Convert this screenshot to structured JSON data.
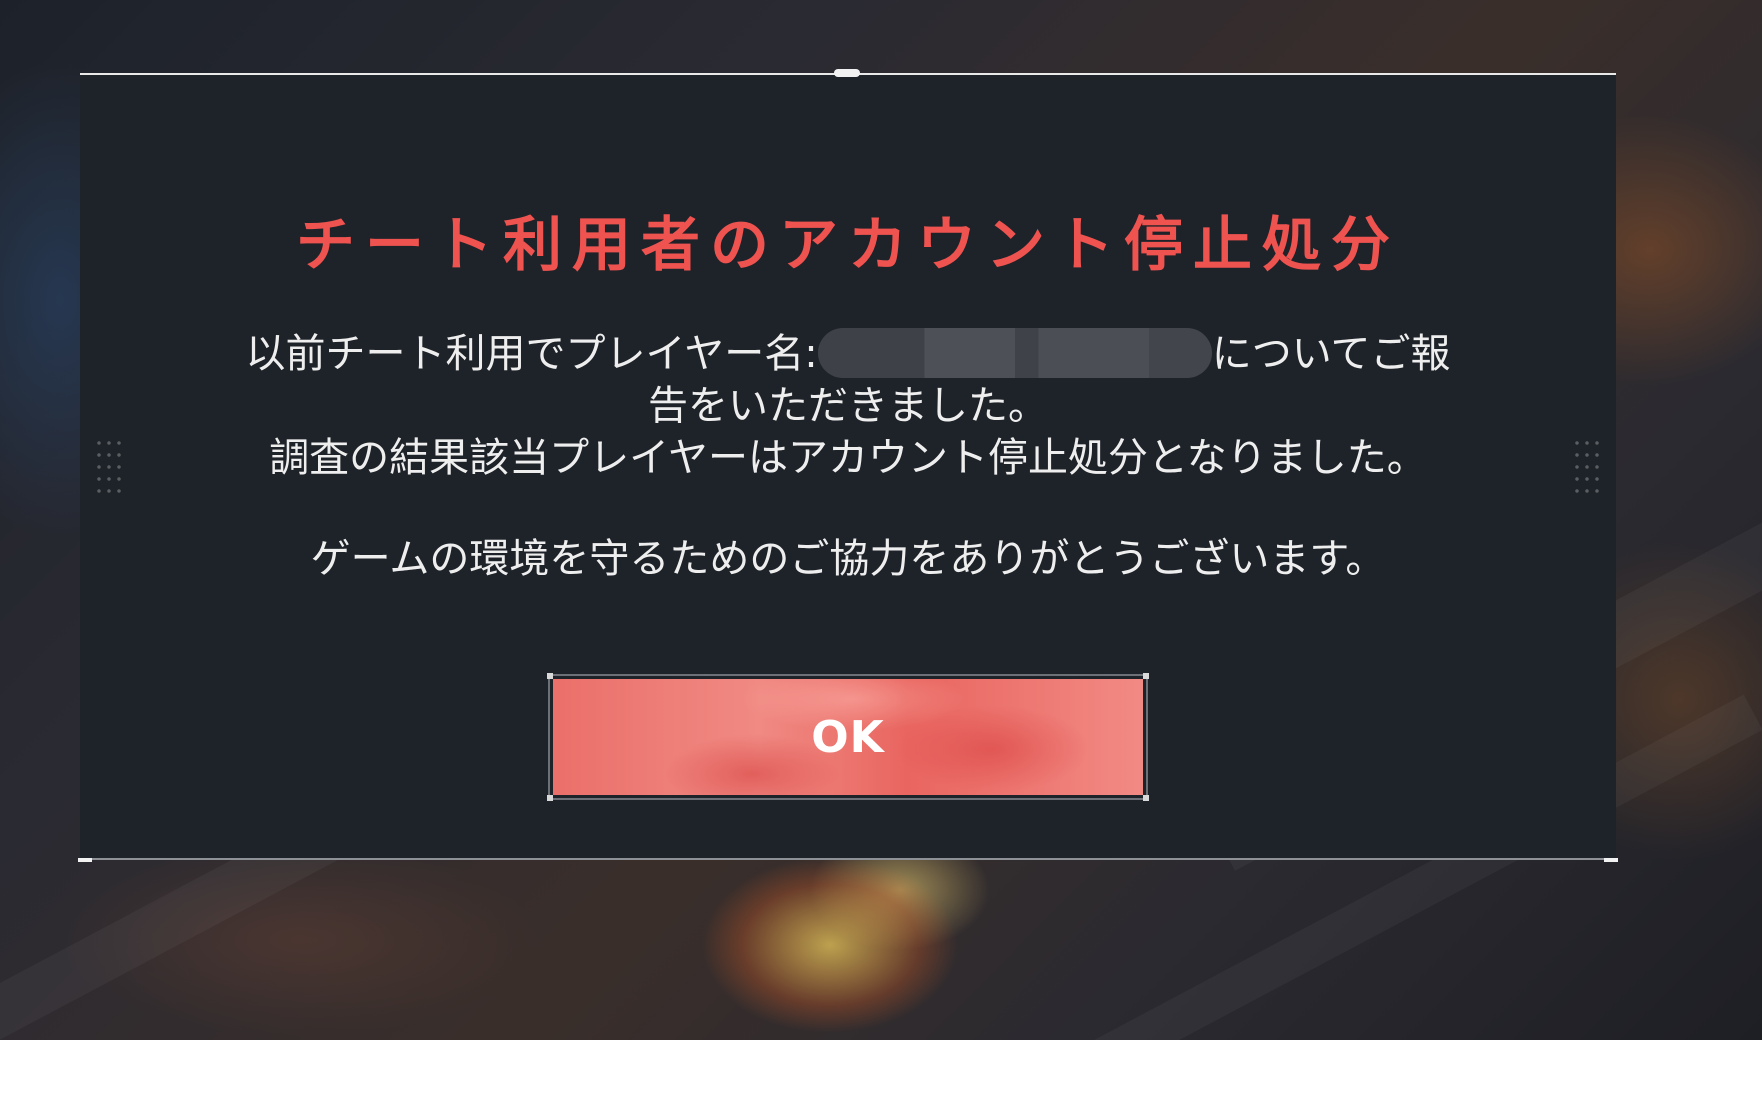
{
  "dialog": {
    "title": "チート利用者のアカウント停止処分",
    "line1_before": "以前チート利用でプレイヤー名:",
    "line1_after": "についてご報",
    "line2": "告をいただきました。",
    "line3": "調査の結果該当プレイヤーはアカウント停止処分となりました。",
    "line4": "ゲームの環境を守るためのご協力をありがとうございます。",
    "ok_label": "OK"
  },
  "colors": {
    "title": "#ef5350",
    "dialog_bg": "#1e2329",
    "button": "#ec7570"
  }
}
